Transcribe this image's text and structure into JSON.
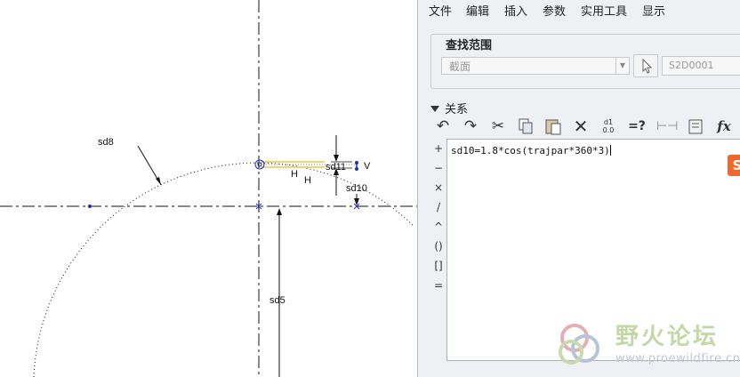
{
  "menu": [
    "文件",
    "编辑",
    "插入",
    "参数",
    "实用工具",
    "显示"
  ],
  "search_scope": {
    "title": "查找范围",
    "type_value": "截面",
    "entity_placeholder": "S2D0001"
  },
  "relations": {
    "title": "关系",
    "toolbar_icons": [
      "undo-icon",
      "redo-icon",
      "cut-icon",
      "copy-icon",
      "paste-icon",
      "delete-icon",
      "switch-dimensions-icon",
      "verify-icon",
      "measure-icon",
      "sort-icon",
      "function-icon"
    ],
    "switch_label": "d1",
    "switch_value": "0.0",
    "verify_label": "=?",
    "function_label": "fx",
    "operators": [
      "+",
      "−",
      "×",
      "/",
      "^",
      "()",
      "[]",
      "="
    ],
    "text": "sd10=1.8*cos(trajpar*360*3)"
  },
  "sketch_labels": {
    "sd8": "sd8",
    "sd11": "sd11",
    "v": "V",
    "h1": "H",
    "h2": "H",
    "sd10": "sd10",
    "sd5": "sd5"
  },
  "watermark": {
    "brand": "野火论坛",
    "url": "www.proewildfire.cn"
  },
  "colors": {
    "panel_bg": "#eef0f3",
    "sketch_line": "#111111",
    "yellow_highlight": "#e8c840",
    "point_blue": "#1b2fb8",
    "badge": "#ee6a2c"
  }
}
